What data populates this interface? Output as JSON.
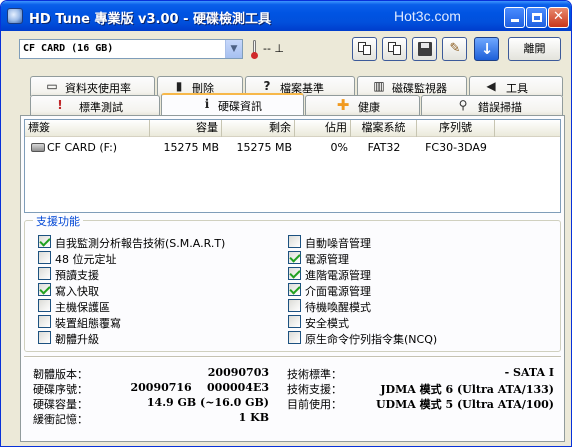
{
  "window": {
    "title": "HD Tune 專業版 v3.00 - 硬碟檢測工具",
    "watermark": "Hot3c.com"
  },
  "toolbar": {
    "drive": "CF CARD  (16 GB)",
    "temperature": "-- ⊥",
    "exit_label": "離開"
  },
  "tabs_top": [
    {
      "label": "資料夾使用率",
      "icon": "folder-icon"
    },
    {
      "label": "刪除",
      "icon": "trash-icon"
    },
    {
      "label": "檔案基準",
      "icon": "file-benchmark-icon"
    },
    {
      "label": "磁碟監視器",
      "icon": "disk-monitor-icon"
    },
    {
      "label": "工具",
      "icon": "speaker-icon"
    }
  ],
  "tabs_bottom": [
    {
      "label": "標準測試",
      "icon": "thermometer-icon"
    },
    {
      "label": "硬碟資訊",
      "icon": "info-icon"
    },
    {
      "label": "健康",
      "icon": "health-cross-icon"
    },
    {
      "label": "錯誤掃描",
      "icon": "magnifier-icon"
    }
  ],
  "partition_table": {
    "columns": [
      "標簽",
      "容量",
      "剩余",
      "佔用",
      "檔案系統",
      "序列號"
    ],
    "rows": [
      {
        "label": "CF CARD (F:)",
        "capacity": "15275 MB",
        "free": "15275 MB",
        "used": "0%",
        "fs": "FAT32",
        "serial": "FC30-3DA9"
      }
    ]
  },
  "features": {
    "title": "支援功能",
    "left": [
      {
        "label": "自我監測分析報告技術(S.M.A.R.T)",
        "checked": true
      },
      {
        "label": "48 位元定址",
        "checked": false
      },
      {
        "label": "預讀支援",
        "checked": false
      },
      {
        "label": "寫入快取",
        "checked": true
      },
      {
        "label": "主機保護區",
        "checked": false
      },
      {
        "label": "裝置組態覆寫",
        "checked": false
      },
      {
        "label": "韌體升級",
        "checked": false
      }
    ],
    "right": [
      {
        "label": "自動噪音管理",
        "checked": false
      },
      {
        "label": "電源管理",
        "checked": true
      },
      {
        "label": "進階電源管理",
        "checked": true
      },
      {
        "label": "介面電源管理",
        "checked": true
      },
      {
        "label": "待機喚醒模式",
        "checked": false
      },
      {
        "label": "安全模式",
        "checked": false
      },
      {
        "label": "原生命令佇列指令集(NCQ)",
        "checked": false
      }
    ]
  },
  "info": {
    "left": [
      {
        "key": "韌體版本：",
        "value": "20090703"
      },
      {
        "key": "硬碟序號：",
        "value": "20090716    000004E3"
      },
      {
        "key": "硬碟容量：",
        "value": "14.9 GB (~16.0 GB)"
      },
      {
        "key": "緩衝記憶：",
        "value": "1 KB"
      }
    ],
    "right": [
      {
        "key": "技術標準：",
        "value": "- SATA I"
      },
      {
        "key": "技術支援：",
        "value": "JDMA 模式 6 (Ultra ATA/133)"
      },
      {
        "key": "目前使用：",
        "value": "UDMA 模式 5 (Ultra ATA/100)"
      }
    ]
  }
}
